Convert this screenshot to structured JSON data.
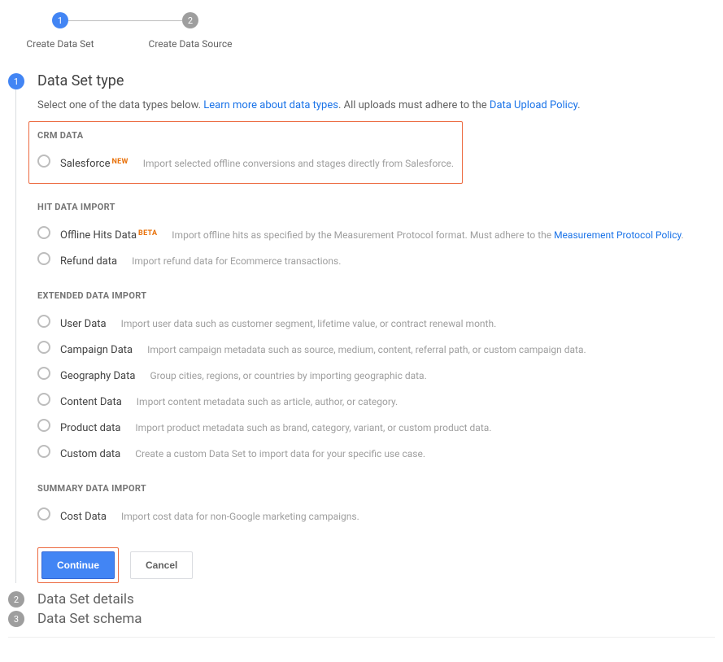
{
  "stepper": {
    "step1": {
      "num": "1",
      "label": "Create Data Set"
    },
    "step2": {
      "num": "2",
      "label": "Create Data Source"
    }
  },
  "section1": {
    "num": "1",
    "title": "Data Set type",
    "subtitle_a": "Select one of the data types below. ",
    "subtitle_link1": "Learn more about data types",
    "subtitle_b": ". All uploads must adhere to the ",
    "subtitle_link2": "Data Upload Policy",
    "subtitle_c": "."
  },
  "groups": {
    "crm": {
      "header": "CRM DATA"
    },
    "hit": {
      "header": "HIT DATA IMPORT"
    },
    "ext": {
      "header": "EXTENDED DATA IMPORT"
    },
    "sum": {
      "header": "SUMMARY DATA IMPORT"
    }
  },
  "opts": {
    "salesforce": {
      "label": "Salesforce",
      "badge": "NEW",
      "desc": "Import selected offline conversions and stages directly from Salesforce."
    },
    "offline": {
      "label": "Offline Hits Data",
      "badge": "BETA",
      "desc_a": "Import offline hits as specified by the Measurement Protocol format. Must adhere to the ",
      "link": "Measurement Protocol Policy",
      "desc_b": "."
    },
    "refund": {
      "label": "Refund data",
      "desc": "Import refund data for Ecommerce transactions."
    },
    "user": {
      "label": "User Data",
      "desc": "Import user data such as customer segment, lifetime value, or contract renewal month."
    },
    "campaign": {
      "label": "Campaign Data",
      "desc": "Import campaign metadata such as source, medium, content, referral path, or custom campaign data."
    },
    "geo": {
      "label": "Geography Data",
      "desc": "Group cities, regions, or countries by importing geographic data."
    },
    "content": {
      "label": "Content Data",
      "desc": "Import content metadata such as article, author, or category."
    },
    "product": {
      "label": "Product data",
      "desc": "Import product metadata such as brand, category, variant, or custom product data."
    },
    "custom": {
      "label": "Custom data",
      "desc": "Create a custom Data Set to import data for your specific use case."
    },
    "cost": {
      "label": "Cost Data",
      "desc": "Import cost data for non-Google marketing campaigns."
    }
  },
  "buttons": {
    "continue": "Continue",
    "cancel": "Cancel"
  },
  "section2": {
    "num": "2",
    "title": "Data Set details"
  },
  "section3": {
    "num": "3",
    "title": "Data Set schema"
  }
}
